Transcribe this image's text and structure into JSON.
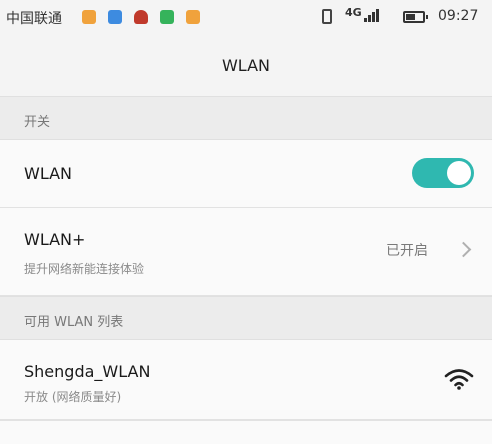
{
  "status_bar": {
    "carrier": "中国联通",
    "network": "4G",
    "time": "09:27",
    "battery_level": 0.55,
    "notification_icons": [
      "app-orange-icon",
      "app-blue-icon",
      "app-red-icon",
      "app-green-icon",
      "app-yellow-icon"
    ]
  },
  "header": {
    "title": "WLAN"
  },
  "sections": {
    "switch_header": "开关",
    "available_header": "可用 WLAN 列表"
  },
  "wlan_toggle": {
    "label": "WLAN",
    "enabled": true,
    "accent_color": "#2fb8b0"
  },
  "wlan_plus": {
    "label": "WLAN+",
    "description": "提升网络新能连接体验",
    "status": "已开启"
  },
  "networks": [
    {
      "ssid": "Shengda_WLAN",
      "detail": "开放 (网络质量好)",
      "icon": "wifi-signal-icon"
    }
  ]
}
